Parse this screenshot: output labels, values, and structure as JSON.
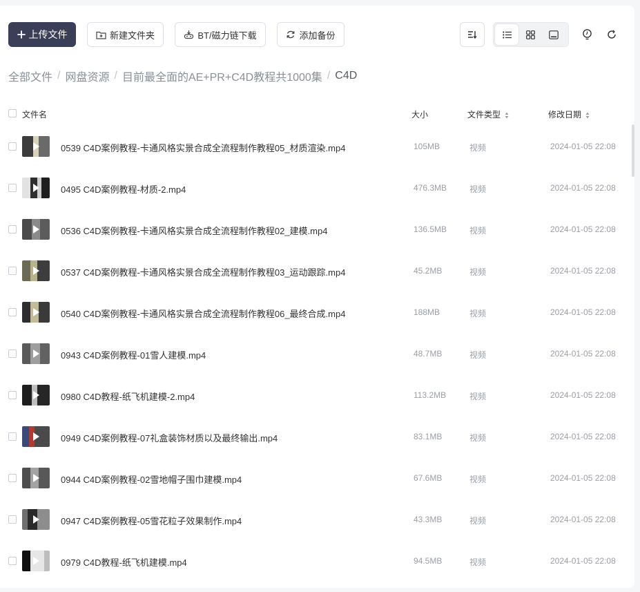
{
  "toolbar": {
    "upload_label": "上传文件",
    "new_folder_label": "新建文件夹",
    "bt_label": "BT/磁力链下载",
    "backup_label": "添加备份"
  },
  "breadcrumb": [
    "全部文件",
    "网盘资源",
    "目前最全面的AE+PR+C4D教程共1000集",
    "C4D"
  ],
  "columns": {
    "name": "文件名",
    "size": "大小",
    "type": "文件类型",
    "date": "修改日期"
  },
  "files": [
    {
      "name": "0539 C4D案例教程-卡通风格实景合成全流程制作教程05_材质渲染.mp4",
      "size": "105MB",
      "type": "视频",
      "date": "2024-01-05 22:08"
    },
    {
      "name": "0495 C4D案例教程-材质-2.mp4",
      "size": "476.3MB",
      "type": "视频",
      "date": "2024-01-05 22:08"
    },
    {
      "name": "0536 C4D案例教程-卡通风格实景合成全流程制作教程02_建模.mp4",
      "size": "136.5MB",
      "type": "视频",
      "date": "2024-01-05 22:08"
    },
    {
      "name": "0537 C4D案例教程-卡通风格实景合成全流程制作教程03_运动跟踪.mp4",
      "size": "45.2MB",
      "type": "视频",
      "date": "2024-01-05 22:08"
    },
    {
      "name": "0540 C4D案例教程-卡通风格实景合成全流程制作教程06_最终合成.mp4",
      "size": "188MB",
      "type": "视频",
      "date": "2024-01-05 22:08"
    },
    {
      "name": "0943 C4D案例教程-01雪人建模.mp4",
      "size": "48.7MB",
      "type": "视频",
      "date": "2024-01-05 22:08"
    },
    {
      "name": "0980 C4D教程-纸飞机建模-2.mp4",
      "size": "113.2MB",
      "type": "视频",
      "date": "2024-01-05 22:08"
    },
    {
      "name": "0949 C4D案例教程-07礼盒装饰材质以及最终输出.mp4",
      "size": "83.1MB",
      "type": "视频",
      "date": "2024-01-05 22:08"
    },
    {
      "name": "0944 C4D案例教程-02雪地帽子围巾建模.mp4",
      "size": "67.6MB",
      "type": "视频",
      "date": "2024-01-05 22:08"
    },
    {
      "name": "0947 C4D案例教程-05雪花粒子效果制作.mp4",
      "size": "43.3MB",
      "type": "视频",
      "date": "2024-01-05 22:08"
    },
    {
      "name": "0979 C4D教程-纸飞机建模.mp4",
      "size": "94.5MB",
      "type": "视频",
      "date": "2024-01-05 22:08"
    }
  ],
  "colors": {
    "primary": "#3a3e57",
    "muted_text": "#9a9ea6"
  }
}
